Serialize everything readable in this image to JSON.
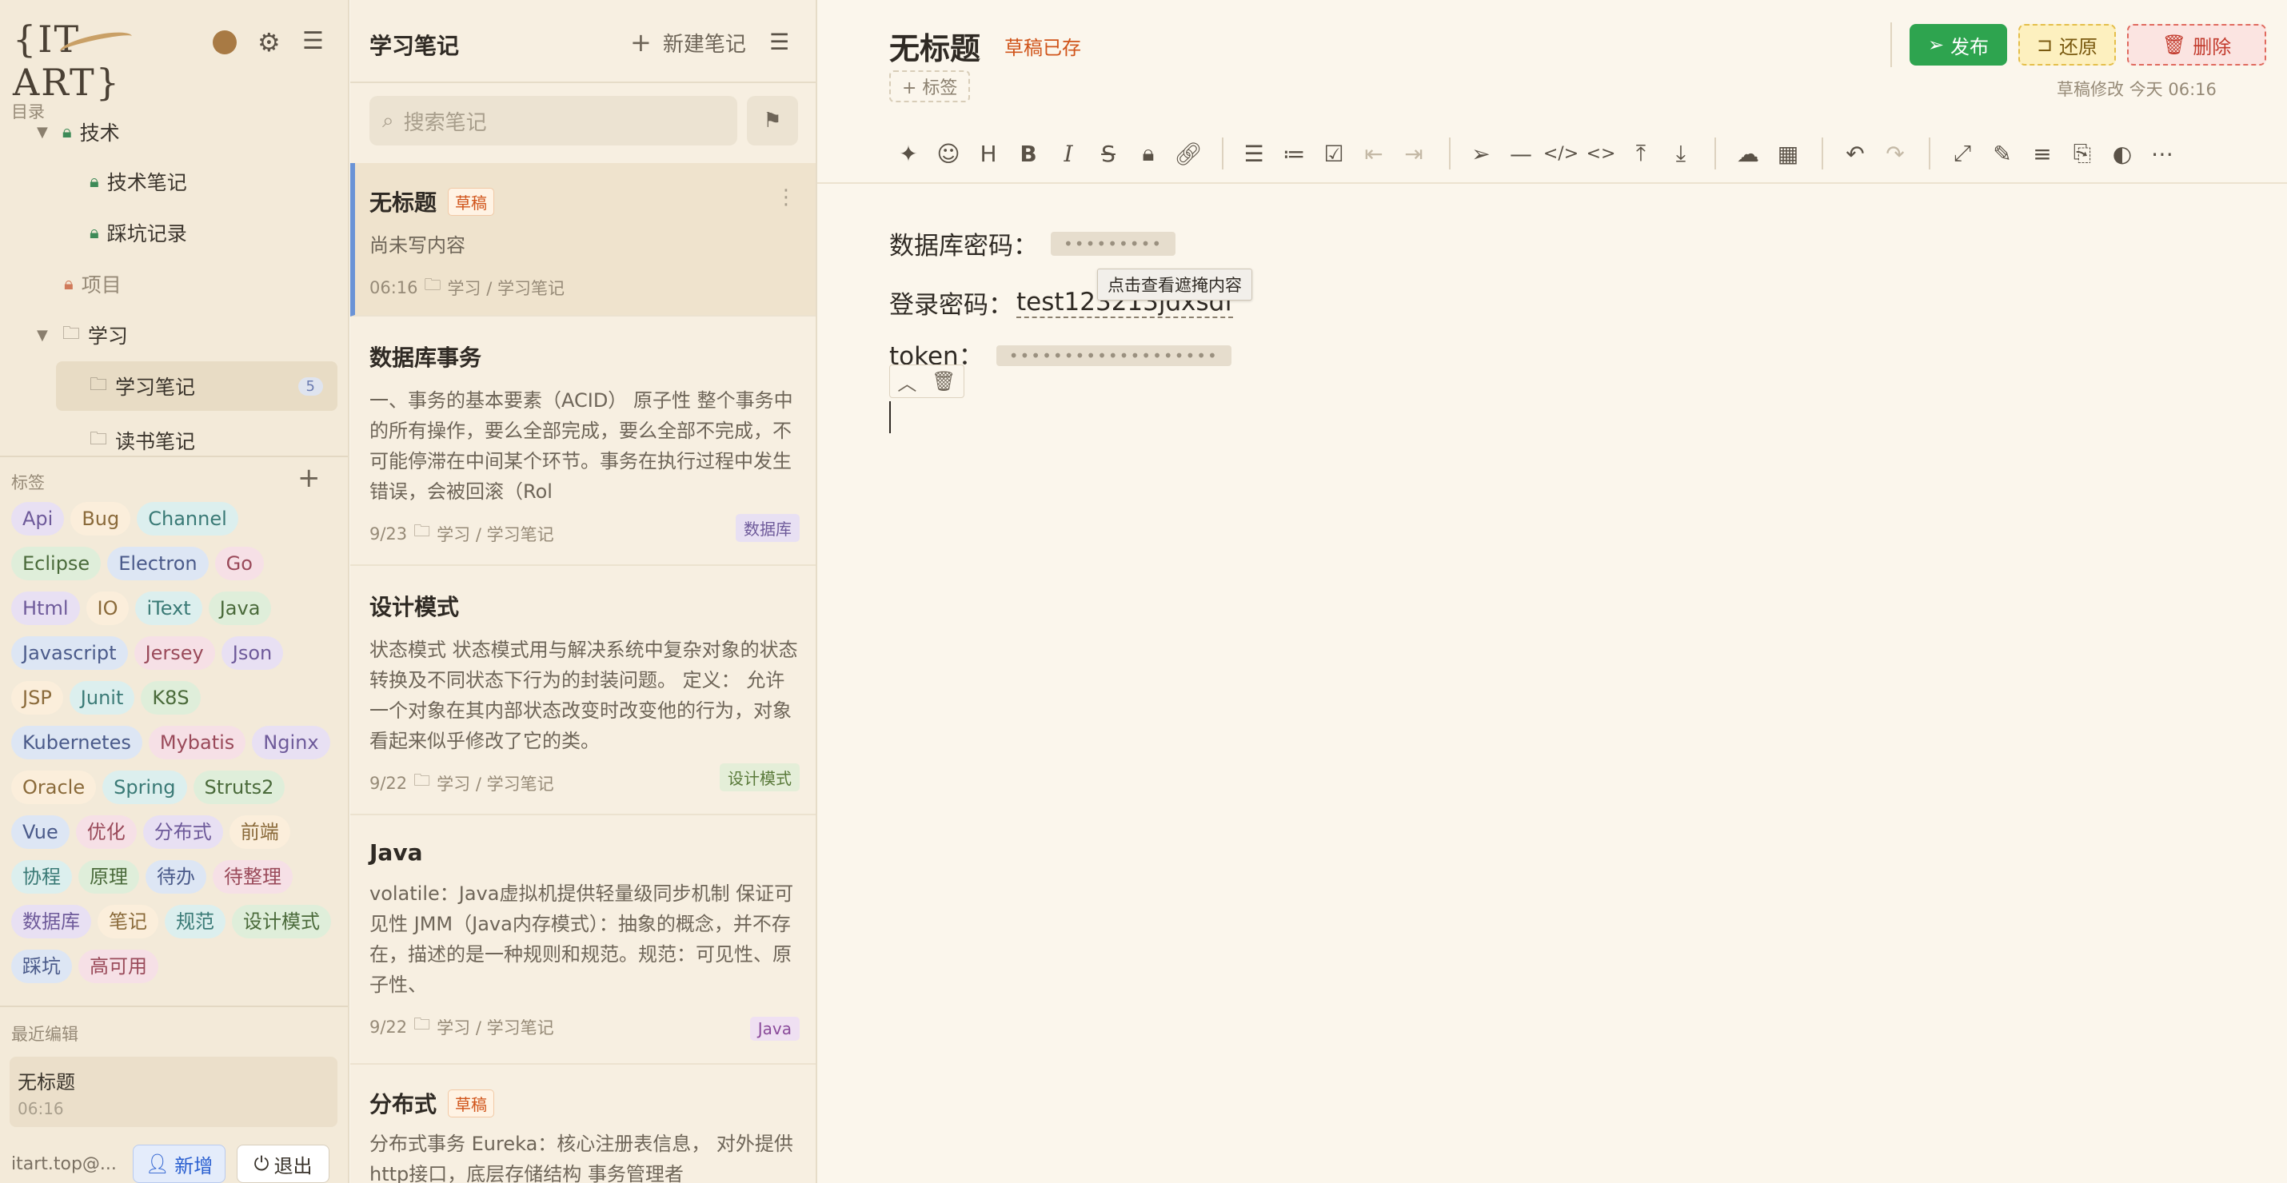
{
  "sidebar": {
    "logo_text": "{IT ART}",
    "catalog_label": "目录",
    "tree": [
      {
        "label": "技术",
        "icon": "lock-icon",
        "expanded": true
      },
      {
        "label": "技术笔记",
        "icon": "lock-icon"
      },
      {
        "label": "踩坑记录",
        "icon": "lock-icon"
      },
      {
        "label": "项目",
        "icon": "lock-icon"
      },
      {
        "label": "学习",
        "icon": "folder-icon",
        "expanded": true
      },
      {
        "label": "学习笔记",
        "icon": "folder-icon",
        "count": "5"
      },
      {
        "label": "读书笔记",
        "icon": "folder-icon"
      }
    ],
    "tags_label": "标签",
    "tags": [
      "Api",
      "Bug",
      "Channel",
      "Eclipse",
      "Electron",
      "Go",
      "Html",
      "IO",
      "iText",
      "Java",
      "Javascript",
      "Jersey",
      "Json",
      "JSP",
      "Junit",
      "K8S",
      "Kubernetes",
      "Mybatis",
      "Nginx",
      "Oracle",
      "Spring",
      "Struts2",
      "Vue",
      "优化",
      "分布式",
      "前端",
      "协程",
      "原理",
      "待办",
      "待整理",
      "数据库",
      "笔记",
      "规范",
      "设计模式",
      "踩坑",
      "高可用"
    ],
    "recent_label": "最近编辑",
    "recent": {
      "title": "无标题",
      "time": "06:16"
    },
    "user": "itart.top@...",
    "add_label": "新增",
    "logout_label": "退出"
  },
  "notelist": {
    "title": "学习笔记",
    "new_label": "新建笔记",
    "search_placeholder": "搜索笔记",
    "notes": [
      {
        "title": "无标题",
        "badge": "草稿",
        "body": "尚未写内容",
        "time": "06:16",
        "path": "学习 / 学习笔记",
        "tag": ""
      },
      {
        "title": "数据库事务",
        "badge": "",
        "body": "一、事务的基本要素（ACID） 原子性 整个事务中的所有操作，要么全部完成，要么全部不完成，不可能停滞在中间某个环节。事务在执行过程中发生错误，会被回滚（Rol",
        "time": "9/23",
        "path": "学习 / 学习笔记",
        "tag": "数据库"
      },
      {
        "title": "设计模式",
        "badge": "",
        "body": "状态模式 状态模式用与解决系统中复杂对象的状态转换及不同状态下行为的封装问题。 定义： 允许一个对象在其内部状态改变时改变他的行为，对象看起来似乎修改了它的类。",
        "time": "9/22",
        "path": "学习 / 学习笔记",
        "tag": "设计模式"
      },
      {
        "title": "Java",
        "badge": "",
        "body": "volatile：Java虚拟机提供轻量级同步机制 保证可见性 JMM（Java内存模式）：抽象的概念，并不存在，描述的是一种规则和规范。规范：可见性、原子性、",
        "time": "9/22",
        "path": "学习 / 学习笔记",
        "tag": "Java"
      },
      {
        "title": "分布式",
        "badge": "草稿",
        "body": "分布式事务 Eureka：核心注册表信息， 对外提供http接口，底层存储结构 事务管理者",
        "time": "",
        "path": "",
        "tag": ""
      }
    ]
  },
  "editor": {
    "title": "无标题",
    "status": "草稿已存",
    "add_tag": "+ 标签",
    "publish": "发布",
    "restore": "还原",
    "delete": "删除",
    "modified": "草稿修改 今天 06:16",
    "lines": [
      {
        "label": "数据库密码：",
        "masked": "•••••••••"
      },
      {
        "label": "登录密码：",
        "value": "test123213jdxsdf"
      },
      {
        "label": "token：",
        "masked": "•••••••••••••••••••"
      }
    ],
    "tooltip": "点击查看遮掩内容"
  },
  "colors": {
    "publish": "#2ea44f",
    "restore_bg": "#fdf0bf",
    "delete_bg": "#fbe4e1",
    "accent": "#d0541a"
  }
}
